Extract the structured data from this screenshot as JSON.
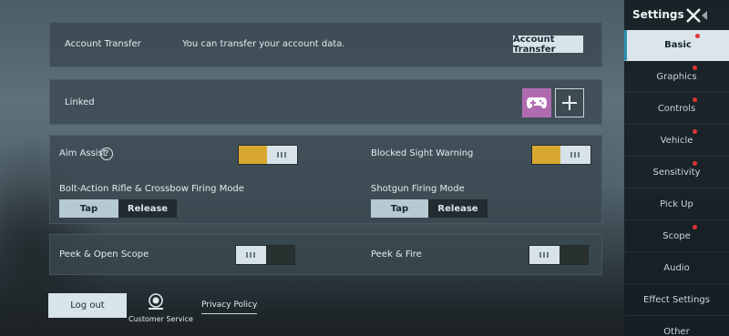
{
  "account": {
    "label": "Account Transfer",
    "desc": "You can transfer your account data.",
    "button": "Account Transfer"
  },
  "linked": {
    "label": "Linked",
    "icons": [
      "gamepad-icon",
      "plus-icon"
    ]
  },
  "controls": {
    "aim_assist": {
      "label": "Aim Assist",
      "on": true
    },
    "blocked_sight": {
      "label": "Blocked Sight Warning",
      "on": true
    },
    "bolt_action": {
      "label": "Bolt-Action Rifle & Crossbow Firing Mode",
      "options": [
        "Tap",
        "Release"
      ],
      "selected": "Tap"
    },
    "shotgun": {
      "label": "Shotgun Firing Mode",
      "options": [
        "Tap",
        "Release"
      ],
      "selected": "Tap"
    },
    "peek_scope": {
      "label": "Peek & Open Scope",
      "on": false
    },
    "peek_fire": {
      "label": "Peek & Fire",
      "on": false
    },
    "toggle_glyph": "III"
  },
  "footer": {
    "logout": "Log out",
    "customer_service": "Customer Service",
    "privacy": "Privacy Policy"
  },
  "sidebar": {
    "title": "Settings",
    "items": [
      {
        "label": "Basic",
        "active": true,
        "dot": true
      },
      {
        "label": "Graphics",
        "active": false,
        "dot": true
      },
      {
        "label": "Controls",
        "active": false,
        "dot": true
      },
      {
        "label": "Vehicle",
        "active": false,
        "dot": true
      },
      {
        "label": "Sensitivity",
        "active": false,
        "dot": true
      },
      {
        "label": "Pick Up",
        "active": false,
        "dot": false
      },
      {
        "label": "Scope",
        "active": false,
        "dot": true
      },
      {
        "label": "Audio",
        "active": false,
        "dot": false
      },
      {
        "label": "Effect Settings",
        "active": false,
        "dot": false
      },
      {
        "label": "Other",
        "active": false,
        "dot": false
      }
    ]
  },
  "colors": {
    "toggle_on": "#d9a832",
    "toggle_off": "#28312f",
    "accent": "#2a8fb0",
    "dot": "#e0343a"
  }
}
